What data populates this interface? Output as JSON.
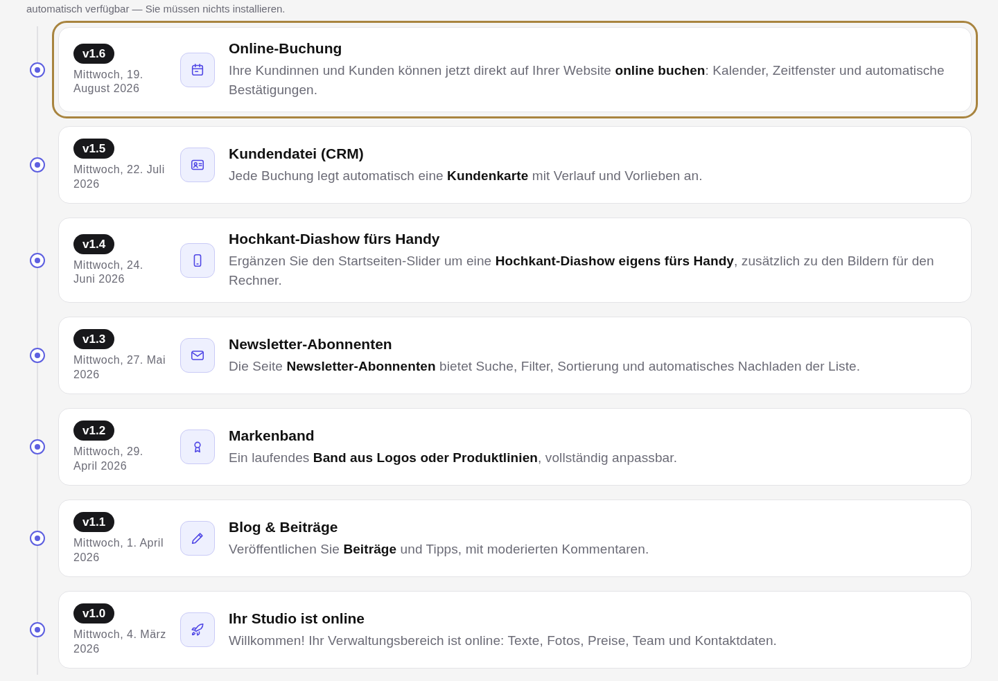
{
  "intro": {
    "text": "automatisch verfügbar — Sie müssen nichts installieren."
  },
  "releases": [
    {
      "version": "v1.6",
      "date": "Mittwoch, 19. August 2026",
      "kind": "calendar",
      "title": "Online-Buchung",
      "description": "Ihre Kundinnen und Kunden können jetzt direkt auf Ihrer Website **online buchen**: Kalender, Zeitfenster und automatische Bestätigungen.",
      "highlighted": true
    },
    {
      "version": "v1.5",
      "date": "Mittwoch, 22. Juli 2026",
      "kind": "contact-card",
      "title": "Kundendatei (CRM)",
      "description": "Jede Buchung legt automatisch eine **Kundenkarte** mit Verlauf und Vorlieben an.",
      "highlighted": false
    },
    {
      "version": "v1.4",
      "date": "Mittwoch, 24. Juni 2026",
      "kind": "phone",
      "title": "Hochkant-Diashow fürs Handy",
      "description": "Ergänzen Sie den Startseiten-Slider um eine **Hochkant-Diashow eigens fürs Handy**, zusätzlich zu den Bildern für den Rechner.",
      "highlighted": false
    },
    {
      "version": "v1.3",
      "date": "Mittwoch, 27. Mai 2026",
      "kind": "mail",
      "title": "Newsletter-Abonnenten",
      "description": "Die Seite **Newsletter-Abonnenten** bietet Suche, Filter, Sortierung und automatisches Nachladen der Liste.",
      "highlighted": false
    },
    {
      "version": "v1.2",
      "date": "Mittwoch, 29. April 2026",
      "kind": "award",
      "title": "Markenband",
      "description": "Ein laufendes **Band aus Logos oder Produktlinien**, vollständig anpassbar.",
      "highlighted": false
    },
    {
      "version": "v1.1",
      "date": "Mittwoch, 1. April 2026",
      "kind": "pencil",
      "title": "Blog & Beiträge",
      "description": "Veröffentlichen Sie **Beiträge** und Tipps, mit moderierten Kommentaren.",
      "highlighted": false
    },
    {
      "version": "v1.0",
      "date": "Mittwoch, 4. März 2026",
      "kind": "rocket",
      "title": "Ihr Studio ist online",
      "description": "Willkommen! Ihr Verwaltungsbereich ist online: Texte, Fotos, Preise, Team und Kontaktdaten.",
      "highlighted": false
    }
  ]
}
